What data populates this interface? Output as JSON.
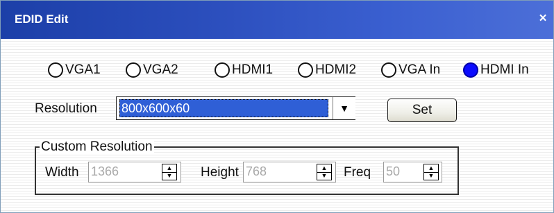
{
  "window": {
    "title": "EDID Edit",
    "close_glyph": "×"
  },
  "sources": [
    {
      "label": "VGA1",
      "selected": false
    },
    {
      "label": "VGA2",
      "selected": false
    },
    {
      "label": "HDMI1",
      "selected": false
    },
    {
      "label": "HDMI2",
      "selected": false
    },
    {
      "label": "VGA In",
      "selected": false
    },
    {
      "label": "HDMI In",
      "selected": true
    }
  ],
  "resolution": {
    "label": "Resolution",
    "value": "800x600x60",
    "arrow_glyph": "▼"
  },
  "set_button": {
    "label": "Set"
  },
  "custom_resolution": {
    "legend": "Custom Resolution",
    "width": {
      "label": "Width",
      "value": "1366"
    },
    "height": {
      "label": "Height",
      "value": "768"
    },
    "freq": {
      "label": "Freq",
      "value": "50"
    }
  },
  "spin_glyphs": {
    "up": "▲",
    "down": "▼"
  },
  "colors": {
    "titlebar": "#1c3fa8",
    "radio_selected": "#0b0bff",
    "selection_highlight": "#2f5fd6"
  }
}
